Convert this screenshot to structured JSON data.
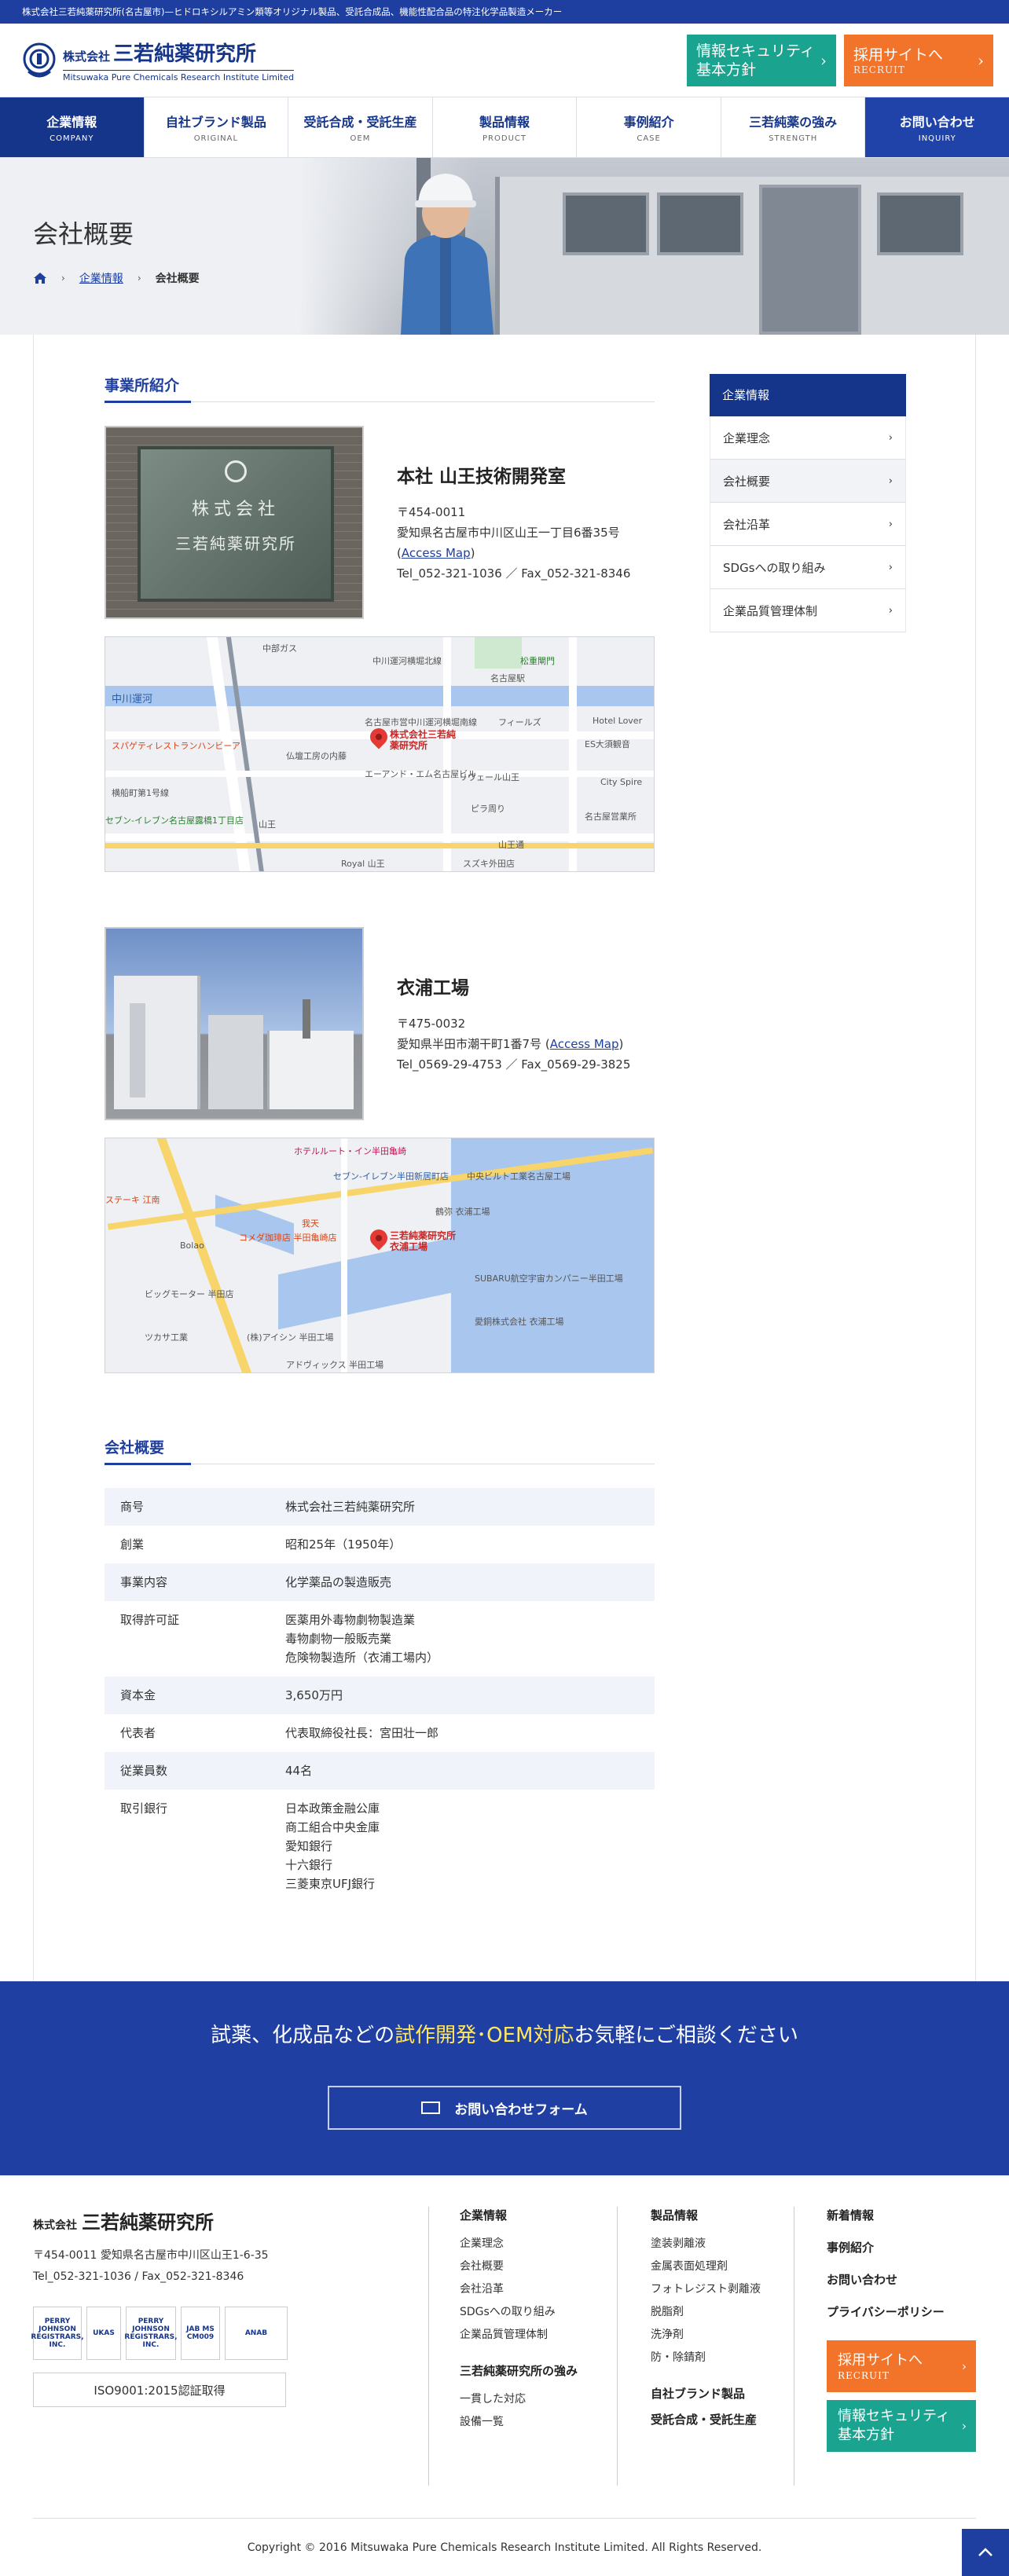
{
  "topbar": {
    "text": "株式会社三若純薬研究所(名古屋市)—ヒドロキシルアミン類等オリジナル製品、受託合成品、機能性配合品の特注化学品製造メーカー"
  },
  "logo": {
    "prefix": "株式会社",
    "name": "三若純薬研究所",
    "en": "Mitsuwaka Pure Chemicals Research Institute Limited"
  },
  "header_buttons": {
    "security": {
      "line1": "情報セキュリティ",
      "line2": "基本方針"
    },
    "recruit": {
      "line1": "採用サイトへ",
      "line2": "RECRUIT"
    }
  },
  "nav": [
    {
      "jp": "企業情報",
      "en": "COMPANY"
    },
    {
      "jp": "自社ブランド製品",
      "en": "ORIGINAL"
    },
    {
      "jp": "受託合成・受託生産",
      "en": "OEM"
    },
    {
      "jp": "製品情報",
      "en": "PRODUCT"
    },
    {
      "jp": "事例紹介",
      "en": "CASE"
    },
    {
      "jp": "三若純薬の強み",
      "en": "STRENGTH"
    },
    {
      "jp": "お問い合わせ",
      "en": "INQUIRY"
    }
  ],
  "hero": {
    "title": "会社概要"
  },
  "breadcrumb": {
    "parent": "企業情報",
    "current": "会社概要"
  },
  "offices_heading": "事業所紹介",
  "offices": [
    {
      "name": "本社 山王技術開発室",
      "zip": "〒454-0011",
      "address": "愛知県名古屋市中川区山王一丁目6番35号",
      "map_link": "Access Map",
      "tel_fax": "Tel_052-321-1036 ／ Fax_052-321-8346",
      "sign_text1": "株式会社",
      "sign_text2": "三若純薬研究所",
      "map_pin_label": "株式会社三若純薬研究所",
      "map_labels": [
        "中川運河横堀北線",
        "中川運河",
        "名古屋市営中川運河横堀南線",
        "フィールズ",
        "Hotel Lover",
        "エーアンド・エム名古屋ビル",
        "リヴェール山王",
        "セブン-イレブン名古屋露橋1丁目店",
        "山王",
        "Royal 山王",
        "スズキ外田店",
        "山王通",
        "City Spire",
        "松重閘門",
        "仏壇工房の内藤",
        "ピラ周り",
        "名古屋駅",
        "横船町第1号線",
        "スパゲティレストランハンビーア",
        "ES大須観音",
        "名古屋営業所",
        "中部ガス"
      ]
    },
    {
      "name": "衣浦工場",
      "zip": "〒475-0032",
      "address": "愛知県半田市潮干町1番7号",
      "map_link": "Access Map",
      "tel_fax": "Tel_0569-29-4753 ／ Fax_0569-29-3825",
      "map_pin_label": "三若純薬研究所 衣浦工場",
      "map_labels": [
        "ホテルルート・イン半田亀崎",
        "セブン-イレブン半田新居町店",
        "中央ビルト工業名古屋工場",
        "鶴弥 衣浦工場",
        "SUBARU航空宇宙カンパニー半田工場",
        "愛銅株式会社 衣浦工場",
        "コメダ珈琲店 半田亀崎店",
        "ステーキ 江南",
        "Bolao",
        "ビッグモーター 半田店",
        "ツカサ工業",
        "(株)アイシン 半田工場",
        "アドヴィックス 半田工場",
        "我天"
      ]
    }
  ],
  "company_heading": "会社概要",
  "company_table": [
    {
      "key": "商号",
      "value": [
        "株式会社三若純薬研究所"
      ]
    },
    {
      "key": "創業",
      "value": [
        "昭和25年（1950年）"
      ]
    },
    {
      "key": "事業内容",
      "value": [
        "化学薬品の製造販売"
      ]
    },
    {
      "key": "取得許可証",
      "value": [
        "医薬用外毒物劇物製造業",
        "毒物劇物一般販売業",
        "危険物製造所（衣浦工場内）"
      ]
    },
    {
      "key": "資本金",
      "value": [
        "3,650万円"
      ]
    },
    {
      "key": "代表者",
      "value": [
        "代表取締役社長：宮田壮一郎"
      ]
    },
    {
      "key": "従業員数",
      "value": [
        "44名"
      ]
    },
    {
      "key": "取引銀行",
      "value": [
        "日本政策金融公庫",
        "商工組合中央金庫",
        "愛知銀行",
        "十六銀行",
        "三菱東京UFJ銀行"
      ]
    }
  ],
  "sidebar": {
    "heading": "企業情報",
    "items": [
      "企業理念",
      "会社概要",
      "会社沿革",
      "SDGsへの取り組み",
      "企業品質管理体制"
    ]
  },
  "cta": {
    "msg_pre": "試薬、化成品などの",
    "msg_hl": "試作開発･OEM対応",
    "msg_post": "お気軽にご相談ください",
    "button": "お問い合わせフォーム"
  },
  "footer": {
    "logo_prefix": "株式会社",
    "logo_name": "三若純薬研究所",
    "address": "〒454-0011 愛知県名古屋市中川区山王1-6-35",
    "tel_fax": "Tel_052-321-1036 / Fax_052-321-8346",
    "certs": [
      "PERRY JOHNSON REGISTRARS, INC.",
      "JAB",
      "UKAS",
      "PERRY JOHNSON REGISTRARS, INC.",
      "JAB MS CM009",
      "ANAB"
    ],
    "iso": "ISO9001:2015認証取得",
    "col1": {
      "h": "企業情報",
      "items": [
        "企業理念",
        "会社概要",
        "会社沿革",
        "SDGsへの取り組み",
        "企業品質管理体制"
      ],
      "h2": "三若純薬研究所の強み",
      "items2": [
        "一貫した対応",
        "設備一覧"
      ]
    },
    "col2": {
      "h": "製品情報",
      "items": [
        "塗装剥離液",
        "金属表面処理剤",
        "フォトレジスト剥離液",
        "脱脂剤",
        "洗浄剤",
        "防・除錆剤"
      ],
      "h2": "自社ブランド製品",
      "h3": "受託合成・受託生産"
    },
    "col3": {
      "items": [
        "新着情報",
        "事例紹介",
        "お問い合わせ",
        "プライバシーポリシー"
      ]
    },
    "recruit": {
      "line1": "採用サイトへ",
      "line2": "RECRUIT"
    },
    "security": {
      "line1": "情報セキュリティ",
      "line2": "基本方針"
    },
    "copyright": "Copyright © 2016 Mitsuwaka Pure Chemicals Research Institute Limited. All Rights Reserved."
  },
  "colors": {
    "brand": "#1e3fa0",
    "teal": "#1aa38f",
    "orange": "#f2742b"
  }
}
